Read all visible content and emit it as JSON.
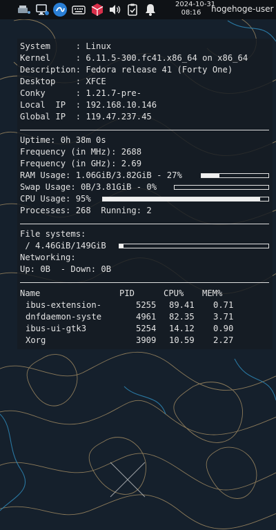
{
  "panel": {
    "date": "2024-10-31",
    "time": "08:16",
    "user": "hogehoge-user",
    "tray_icons": [
      "network-workgroup-icon",
      "monitor-display-icon",
      "input-method-icon",
      "keyboard-icon",
      "package-box-icon",
      "volume-icon",
      "clipboard-icon",
      "notification-bell-icon"
    ]
  },
  "conky": {
    "system_lines": [
      "System     : Linux",
      "Kernel     : 6.11.5-300.fc41.x86_64 on x86_64",
      "Description: Fedora release 41 (Forty One)",
      "Desktop    : XFCE",
      "Conky      : 1.21.7-pre-",
      "Local  IP  : 192.168.10.146",
      "Global IP  : 119.47.237.45"
    ],
    "uptime": "Uptime: 0h 38m 0s",
    "freq_mhz": "Frequency (in MHz): 2688",
    "freq_ghz": "Frequency (in GHz): 2.69",
    "ram": {
      "label": "RAM Usage: 1.06GiB/3.82GiB - 27%",
      "percent": 27
    },
    "swap": {
      "label": "Swap Usage: 0B/3.81GiB - 0%",
      "percent": 0
    },
    "cpu": {
      "label": "CPU Usage: 95%",
      "percent": 95
    },
    "processes": "Processes: 268  Running: 2",
    "fs_heading": "File systems:",
    "fs_root": {
      "label": " / 4.46GiB/149GiB",
      "percent": 3
    },
    "net_heading": "Networking:",
    "net_line": "Up: 0B  - Down: 0B",
    "table": {
      "headers": [
        "Name",
        "PID",
        "CPU%",
        "MEM%"
      ],
      "rows": [
        [
          "ibus-extension-",
          "5255",
          "89.41",
          "0.71"
        ],
        [
          "dnfdaemon-syste",
          "4961",
          "82.35",
          "3.71"
        ],
        [
          "ibus-ui-gtk3",
          "5254",
          "14.12",
          "0.90"
        ],
        [
          "Xorg",
          "3909",
          "10.59",
          "2.27"
        ]
      ]
    }
  },
  "colors": {
    "panel_bg": "#0f1216",
    "conky_text": "#e4e4e4",
    "wallpaper_bg": "#15202c",
    "contour_tan": "#b59a6a",
    "contour_blue": "#2f8fc0"
  }
}
